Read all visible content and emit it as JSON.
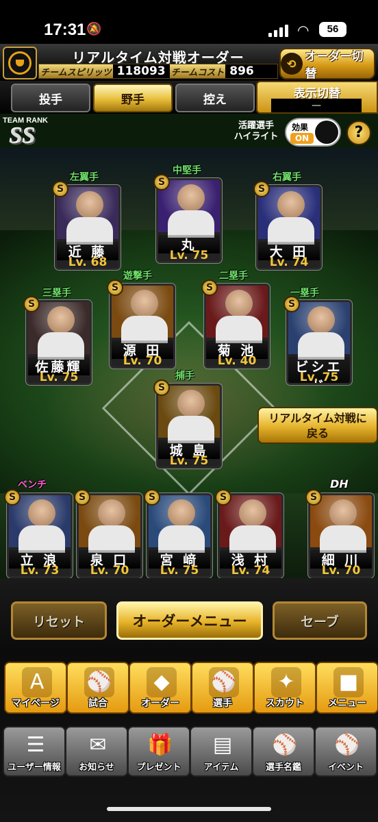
{
  "status": {
    "time": "17:31",
    "battery": "56"
  },
  "header": {
    "title": "リアルタイム対戦オーダー",
    "spirits_label": "チームスピリッツ",
    "spirits_value": "118093",
    "cost_label": "チームコスト",
    "cost_value": "896",
    "order_switch": "オーダー切替"
  },
  "tabs": [
    "投手",
    "野手",
    "控え"
  ],
  "active_tab": "野手",
  "display_switch": {
    "label": "表示切替",
    "value": "—"
  },
  "team_rank": {
    "label": "TEAM RANK",
    "rank": "SS"
  },
  "highlight": {
    "label1": "活躍選手",
    "label2": "ハイライト"
  },
  "effect": {
    "label": "効果",
    "state": "ON"
  },
  "help": "?",
  "grade_letter": "S",
  "lineup": [
    {
      "pos": "左翼手",
      "name": "近 藤",
      "lv": "Lv. 68",
      "pos_color": "#6fe06a"
    },
    {
      "pos": "中堅手",
      "name": "丸",
      "lv": "Lv. 75",
      "pos_color": "#6fe06a"
    },
    {
      "pos": "右翼手",
      "name": "大 田",
      "lv": "Lv. 74",
      "pos_color": "#6fe06a"
    },
    {
      "pos": "三塁手",
      "name": "佐藤輝",
      "lv": "Lv. 75",
      "pos_color": "#6fe06a"
    },
    {
      "pos": "遊撃手",
      "name": "源 田",
      "lv": "Lv. 70",
      "pos_color": "#6fe06a"
    },
    {
      "pos": "二塁手",
      "name": "菊 池",
      "lv": "Lv. 40",
      "pos_color": "#6fe06a"
    },
    {
      "pos": "一塁手",
      "name": "ビシエド",
      "lv": "Lv. 75",
      "pos_color": "#6fe06a"
    },
    {
      "pos": "捕手",
      "name": "城 島",
      "lv": "Lv. 75",
      "pos_color": "#6fe06a"
    }
  ],
  "return_button": {
    "line1": "リアルタイム対戦に",
    "line2": "戻る"
  },
  "bench_label": "ベンチ",
  "dh_label": "DH",
  "bench": [
    {
      "name": "立 浪",
      "lv": "Lv. 73"
    },
    {
      "name": "泉 口",
      "lv": "Lv. 70"
    },
    {
      "name": "宮 﨑",
      "lv": "Lv. 75"
    },
    {
      "name": "浅 村",
      "lv": "Lv. 74"
    },
    {
      "name": "細 川",
      "lv": "Lv. 70"
    }
  ],
  "actions": {
    "reset": "リセット",
    "menu": "オーダーメニュー",
    "save": "セーブ"
  },
  "nav_primary": [
    {
      "label": "マイページ",
      "icon": "A"
    },
    {
      "label": "試合",
      "icon": "⚾"
    },
    {
      "label": "オーダー",
      "icon": "◆"
    },
    {
      "label": "選手",
      "icon": "⚾"
    },
    {
      "label": "スカウト",
      "icon": "✦"
    },
    {
      "label": "メニュー",
      "icon": "■"
    }
  ],
  "nav_secondary": [
    {
      "label": "ユーザー情報",
      "icon": "☰"
    },
    {
      "label": "お知らせ",
      "icon": "✉"
    },
    {
      "label": "プレゼント",
      "icon": "🎁"
    },
    {
      "label": "アイテム",
      "icon": "▤"
    },
    {
      "label": "選手名鑑",
      "icon": "⚾"
    },
    {
      "label": "イベント",
      "icon": "⚾"
    }
  ]
}
